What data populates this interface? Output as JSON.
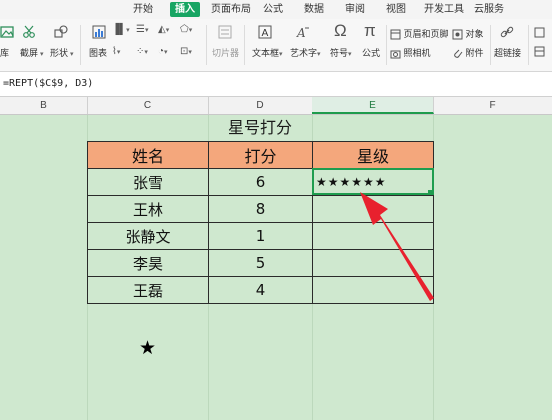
{
  "tabs": [
    "开始",
    "插入",
    "页面布局",
    "公式",
    "数据",
    "审阅",
    "视图",
    "开发工具",
    "云服务"
  ],
  "active_tab": "插入",
  "ribbon": {
    "screenshot_label": "截屏",
    "screenshot_partial": "库",
    "shape_label": "形状",
    "chart_label": "图表",
    "slicer_label": "切片器",
    "textbox_label": "文本框",
    "wordart_label": "艺术字",
    "symbol_label": "符号",
    "formula_label": "公式",
    "header_footer_label": "页眉和页脚",
    "object_label": "对象",
    "camera_label": "照相机",
    "attachment_label": "附件",
    "hyperlink_label": "超链接",
    "symbol_glyph": "Ω",
    "formula_glyph": "π"
  },
  "formula_bar": {
    "formula": "=REPT($C$9, D3)"
  },
  "columns": [
    "B",
    "C",
    "D",
    "E",
    "F"
  ],
  "selected_column": "E",
  "sheet": {
    "title": "星号打分",
    "headers": [
      "姓名",
      "打分",
      "星级"
    ],
    "rows": [
      {
        "name": "张雪",
        "score": "6",
        "stars": "★★★★★★"
      },
      {
        "name": "王林",
        "score": "8",
        "stars": ""
      },
      {
        "name": "张静文",
        "score": "1",
        "stars": ""
      },
      {
        "name": "李昊",
        "score": "5",
        "stars": ""
      },
      {
        "name": "王磊",
        "score": "4",
        "stars": ""
      }
    ],
    "star_symbol": "★"
  },
  "colors": {
    "accent": "#17a563",
    "header_fill": "#f4a77c",
    "sheet_bg": "#cfe8cf",
    "arrow": "#e8212e"
  }
}
